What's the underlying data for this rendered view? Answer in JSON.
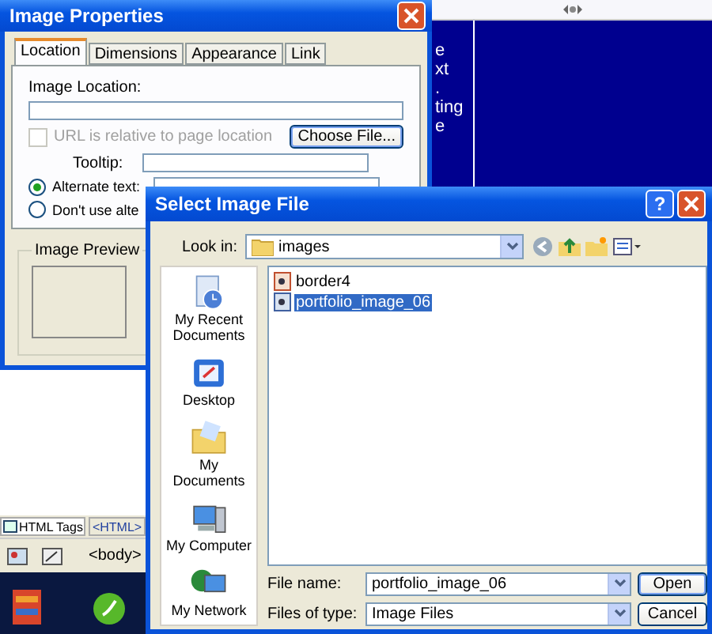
{
  "editor": {
    "text_fragments": [
      "e",
      "xt",
      ".",
      "ting",
      "e"
    ],
    "bottom_tabs": [
      {
        "label": "HTML Tags",
        "selected": true
      },
      {
        "label": "<HTML>",
        "selected": false
      }
    ],
    "tag_bar": {
      "tag": "<body>"
    }
  },
  "image_properties": {
    "title": "Image Properties",
    "tabs": [
      {
        "label": "Location",
        "selected": true
      },
      {
        "label": "Dimensions",
        "selected": false
      },
      {
        "label": "Appearance",
        "selected": false
      },
      {
        "label": "Link",
        "selected": false
      }
    ],
    "image_location": {
      "label": "Image Location:"
    },
    "url_relative": {
      "label": "URL is relative to page location",
      "checked": false,
      "disabled": true
    },
    "choose_button": "Choose File...",
    "tooltip": {
      "label": "Tooltip:"
    },
    "alt_options": [
      {
        "label": "Alternate text:",
        "selected": true
      },
      {
        "label": "Don't use alte",
        "selected": false
      }
    ],
    "preview": {
      "label": "Image Preview"
    }
  },
  "select_file": {
    "title": "Select Image File",
    "help_button": "?",
    "look_in": {
      "label": "Look in:",
      "value": "images"
    },
    "places": [
      {
        "label": "My Recent Documents",
        "kind": "recent"
      },
      {
        "label": "Desktop",
        "kind": "desktop"
      },
      {
        "label": "My Documents",
        "kind": "documents"
      },
      {
        "label": "My Computer",
        "kind": "computer"
      },
      {
        "label": "My Network",
        "kind": "network"
      }
    ],
    "files": [
      {
        "name": "border4",
        "selected": false
      },
      {
        "name": "portfolio_image_06",
        "selected": true
      }
    ],
    "file_name": {
      "label": "File name:",
      "value": "portfolio_image_06"
    },
    "file_type": {
      "label": "Files of type:",
      "value": "Image Files"
    },
    "buttons": [
      "Open",
      "Cancel"
    ]
  }
}
